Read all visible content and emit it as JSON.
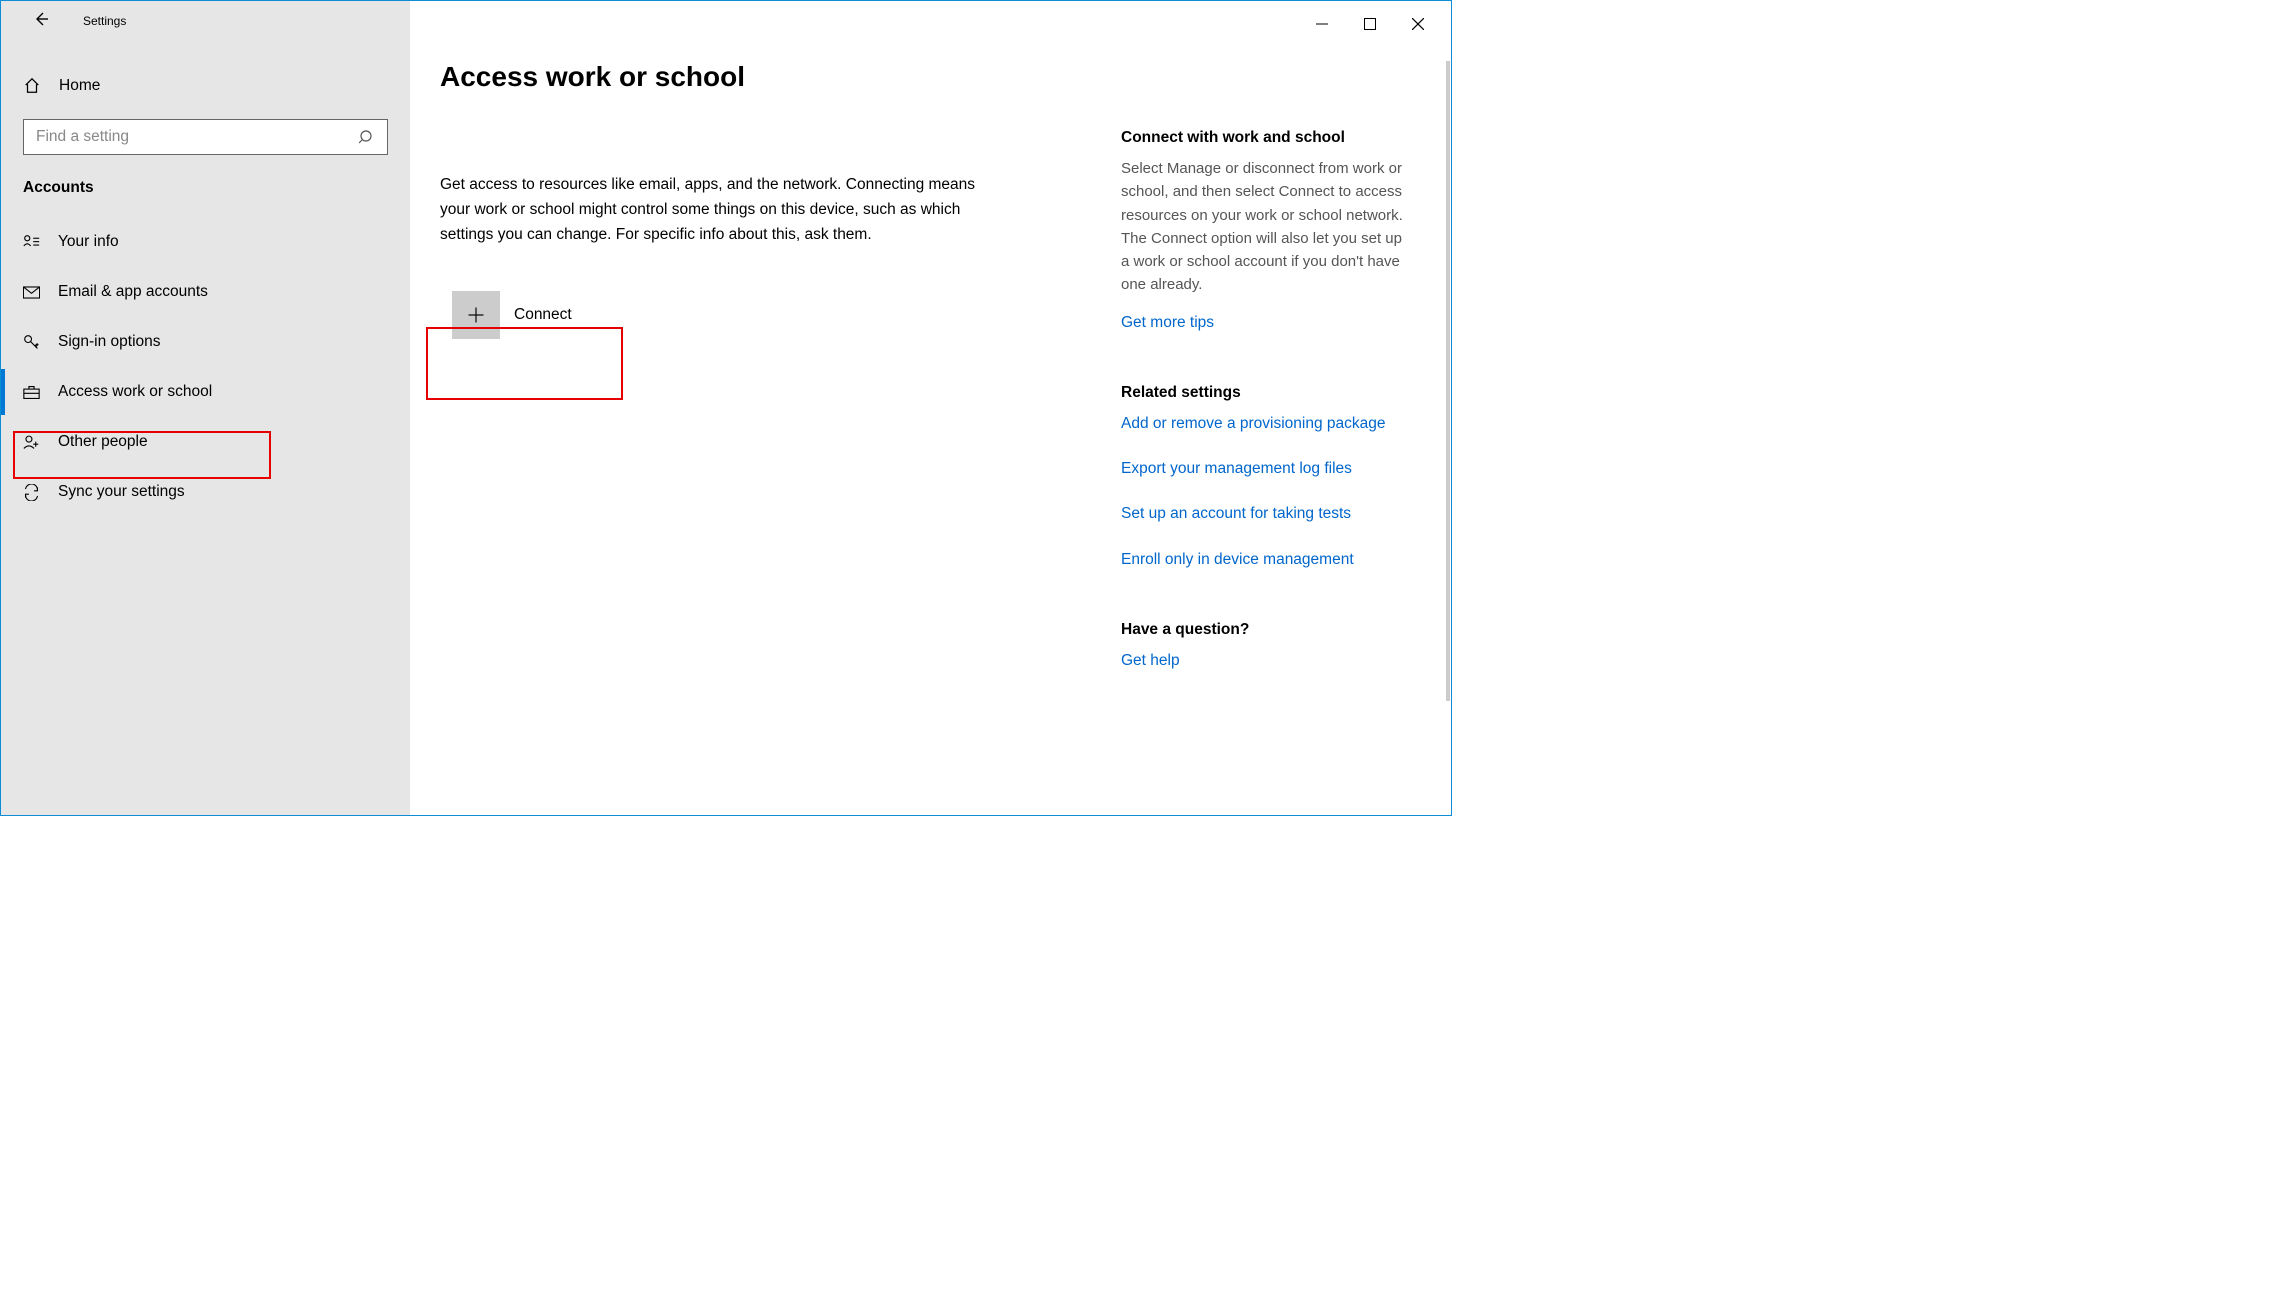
{
  "window": {
    "title": "Settings"
  },
  "sidebar": {
    "home": "Home",
    "search_placeholder": "Find a setting",
    "section": "Accounts",
    "items": [
      {
        "label": "Your info"
      },
      {
        "label": "Email & app accounts"
      },
      {
        "label": "Sign-in options"
      },
      {
        "label": "Access work or school"
      },
      {
        "label": "Other people"
      },
      {
        "label": "Sync your settings"
      }
    ]
  },
  "main": {
    "title": "Access work or school",
    "description": "Get access to resources like email, apps, and the network. Connecting means your work or school might control some things on this device, such as which settings you can change. For specific info about this, ask them.",
    "connect_label": "Connect"
  },
  "right": {
    "connect_heading": "Connect with work and school",
    "connect_desc": "Select Manage or disconnect from work or school, and then select Connect to access resources on your work or school network. The Connect option will also let you set up a work or school account if you don't have one already.",
    "tips_link": "Get more tips",
    "related_heading": "Related settings",
    "related_links": [
      "Add or remove a provisioning package",
      "Export your management log files",
      "Set up an account for taking tests",
      "Enroll only in device management"
    ],
    "question_heading": "Have a question?",
    "help_link": "Get help"
  }
}
